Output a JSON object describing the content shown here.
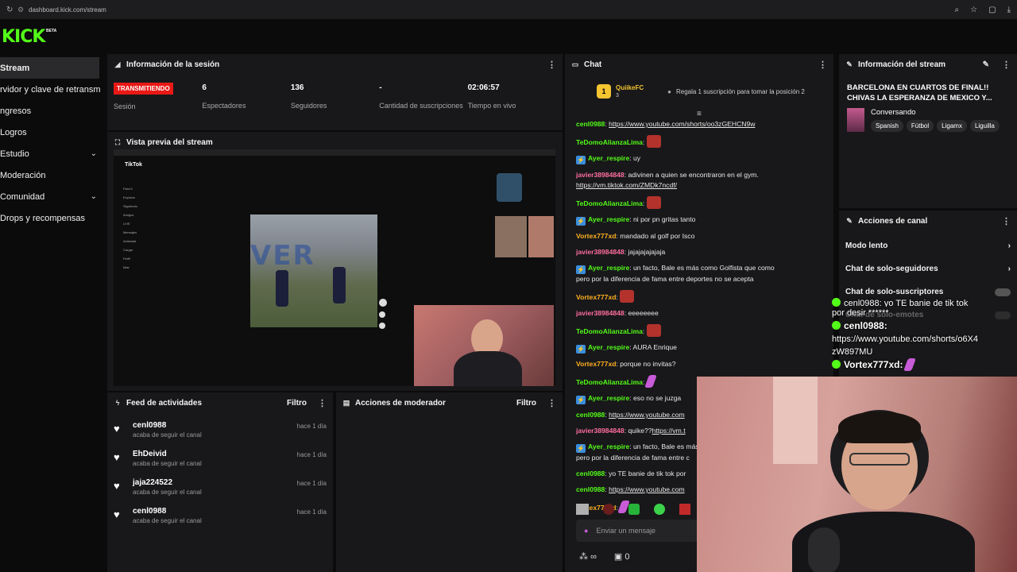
{
  "browser": {
    "url": "dashboard.kick.com/stream"
  },
  "logo": {
    "text": "KICK",
    "beta": "BETA"
  },
  "sidebar": {
    "items": [
      {
        "label": "Stream"
      },
      {
        "label": "rvidor y clave de retransm"
      },
      {
        "label": "ngresos"
      },
      {
        "label": "Logros"
      },
      {
        "label": "Estudio"
      },
      {
        "label": "Moderación"
      },
      {
        "label": "Comunidad"
      },
      {
        "label": "Drops y recompensas"
      }
    ]
  },
  "session": {
    "title": "Información de la sesión",
    "status_badge": "TRANSMITIENDO",
    "status_label": "Sesión",
    "viewers": "6",
    "viewers_label": "Espectadores",
    "followers": "136",
    "followers_label": "Seguidores",
    "subs": "-",
    "subs_label": "Cantidad de suscripciones",
    "uptime": "02:06:57",
    "uptime_label": "Tiempo en vivo"
  },
  "preview": {
    "title": "Vista previa del stream",
    "tiktok_logo": "TikTok",
    "tiktok_menu": [
      "Para ti",
      "Explorar",
      "Siguiendo",
      "Amigos",
      "LIVE",
      "Mensajes",
      "Actividad",
      "Cargar",
      "Perfil",
      "Más"
    ]
  },
  "activity": {
    "title": "Feed de actividades",
    "filter": "Filtro",
    "items": [
      {
        "name": "cenl0988",
        "desc": "acaba de seguir el canal",
        "time": "hace 1 día"
      },
      {
        "name": "EhDeivid",
        "desc": "acaba de seguir el canal",
        "time": "hace 1 día"
      },
      {
        "name": "jaja224522",
        "desc": "acaba de seguir el canal",
        "time": "hace 1 día"
      },
      {
        "name": "cenl0988",
        "desc": "acaba de seguir el canal",
        "time": "hace 1 día"
      }
    ]
  },
  "modactions": {
    "title": "Acciones de moderador",
    "filter": "Filtro"
  },
  "chat": {
    "title": "Chat",
    "top_user": "QuiikeFC",
    "top_rank": "1",
    "top_count": "3",
    "top_msg": "Regala 1 suscripción para tomar la posición 2",
    "input_placeholder": "Enviar un mensaje",
    "infinity": "∞",
    "points": "0",
    "messages": [
      {
        "user": "cenl0988",
        "cls": "u-green",
        "text": "",
        "link": "https://www.youtube.com/shorts/oo3zGEHCN9w"
      },
      {
        "user": "TeDomoAlianzaLima",
        "cls": "u-green",
        "text": "",
        "emote": "red"
      },
      {
        "user": "Ayer_respire",
        "cls": "u-green",
        "text": "uy",
        "badge": true
      },
      {
        "user": "javier38984848",
        "cls": "u-pink",
        "text": "adivinen a quien se encontraron en el gym.",
        "link2": "https://vm.tiktok.com/ZMDk7ncdf/"
      },
      {
        "user": "TeDomoAlianzaLima",
        "cls": "u-green",
        "text": "",
        "emote": "red"
      },
      {
        "user": "Ayer_respire",
        "cls": "u-green",
        "text": "ni por pn gritas tanto",
        "badge": true
      },
      {
        "user": "Vortex777xd",
        "cls": "u-orange",
        "text": "mandado al golf por Isco"
      },
      {
        "user": "javier38984848",
        "cls": "u-pink",
        "text": "jajajajajajaja"
      },
      {
        "user": "Ayer_respire",
        "cls": "u-green",
        "text": "un facto, Bale es más como Golfista que como Futbolista",
        "line2": "pero por la diferencia de fama entre deportes no se acepta",
        "badge": true
      },
      {
        "user": "Vortex777xd",
        "cls": "u-orange",
        "text": "",
        "emote": "red"
      },
      {
        "user": "javier38984848",
        "cls": "u-pink",
        "text": "eeeeeeee"
      },
      {
        "user": "TeDomoAlianzaLima",
        "cls": "u-green",
        "text": "",
        "emote": "red"
      },
      {
        "user": "Ayer_respire",
        "cls": "u-green",
        "text": "AURA Enrique",
        "badge": true
      },
      {
        "user": "Vortex777xd",
        "cls": "u-orange",
        "text": "porque no invitas?"
      },
      {
        "user": "TeDomoAlianzaLima",
        "cls": "u-green",
        "text": "",
        "emote": "feather"
      },
      {
        "user": "Ayer_respire",
        "cls": "u-green",
        "text": "eso no se juzga",
        "badge": true
      },
      {
        "user": "cenl0988",
        "cls": "u-green",
        "text": "",
        "link": "https://www.youtube.com"
      },
      {
        "user": "javier38984848",
        "cls": "u-pink",
        "text": "quike??",
        "link": "https://vm.t"
      },
      {
        "user": "Ayer_respire",
        "cls": "u-green",
        "text": "un facto, Bale es más como",
        "line2": "pero por la diferencia de fama entre c",
        "badge": true
      },
      {
        "user": "cenl0988",
        "cls": "u-green",
        "text": "yo TE banie de tik tok por"
      },
      {
        "user": "cenl0988",
        "cls": "u-green",
        "text": "",
        "link": "https://www.youtube.com"
      },
      {
        "user": "Vortex777xd",
        "cls": "u-orange",
        "text": "",
        "emote": "feather"
      }
    ]
  },
  "stream_info": {
    "title": "Información del stream",
    "stream_title": "BARCELONA EN CUARTOS DE FINAL!! CHIVAS LA ESPERANZA DE MEXICO Y...",
    "category": "Conversando",
    "tags": [
      "Spanish",
      "Fútbol",
      "Ligamx",
      "Liguilla"
    ]
  },
  "channel_actions": {
    "title": "Acciones de canal",
    "items": [
      {
        "label": "Modo lento"
      },
      {
        "label": "Chat de solo-seguidores"
      },
      {
        "label": "Chat de solo-suscriptores"
      },
      {
        "label": "Chat de solo-emotes"
      }
    ]
  },
  "overlay_chat": {
    "line1": "cenl0988: yo TE banie de tik tok",
    "line2": "por desir ******",
    "name2": "cenl0988:",
    "line3": "https://www.youtube.com/shorts/o6X4",
    "line4": "zW897MU",
    "name3": "Vortex777xd:"
  }
}
